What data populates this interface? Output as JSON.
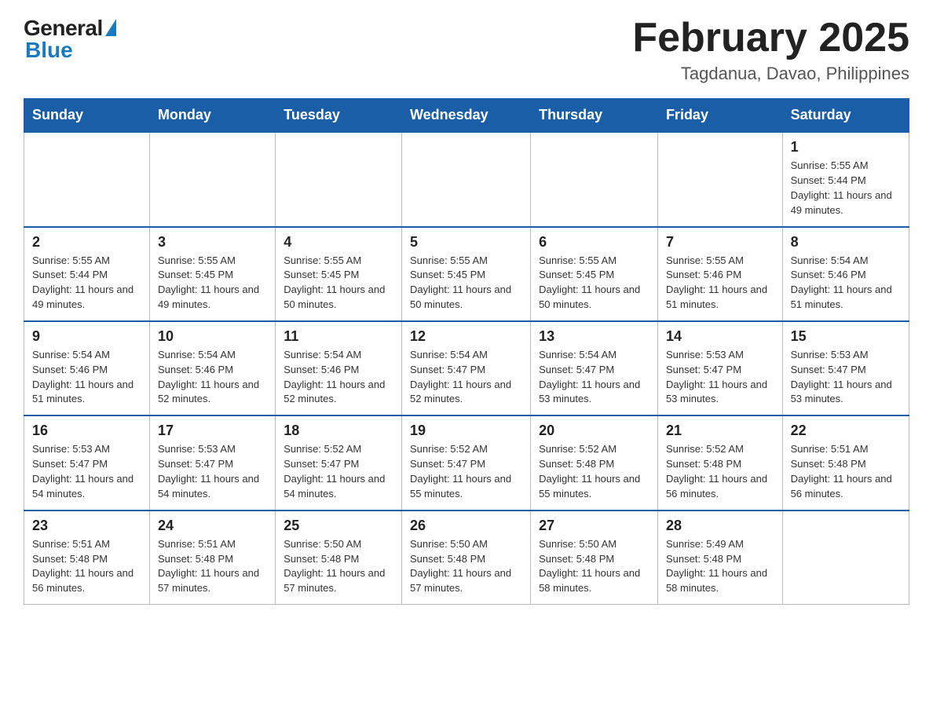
{
  "logo": {
    "general": "General",
    "blue": "Blue"
  },
  "header": {
    "month_title": "February 2025",
    "location": "Tagdanua, Davao, Philippines"
  },
  "days_of_week": [
    "Sunday",
    "Monday",
    "Tuesday",
    "Wednesday",
    "Thursday",
    "Friday",
    "Saturday"
  ],
  "weeks": [
    [
      {
        "day": "",
        "sunrise": "",
        "sunset": "",
        "daylight": "",
        "empty": true
      },
      {
        "day": "",
        "sunrise": "",
        "sunset": "",
        "daylight": "",
        "empty": true
      },
      {
        "day": "",
        "sunrise": "",
        "sunset": "",
        "daylight": "",
        "empty": true
      },
      {
        "day": "",
        "sunrise": "",
        "sunset": "",
        "daylight": "",
        "empty": true
      },
      {
        "day": "",
        "sunrise": "",
        "sunset": "",
        "daylight": "",
        "empty": true
      },
      {
        "day": "",
        "sunrise": "",
        "sunset": "",
        "daylight": "",
        "empty": true
      },
      {
        "day": "1",
        "sunrise": "Sunrise: 5:55 AM",
        "sunset": "Sunset: 5:44 PM",
        "daylight": "Daylight: 11 hours and 49 minutes.",
        "empty": false
      }
    ],
    [
      {
        "day": "2",
        "sunrise": "Sunrise: 5:55 AM",
        "sunset": "Sunset: 5:44 PM",
        "daylight": "Daylight: 11 hours and 49 minutes.",
        "empty": false
      },
      {
        "day": "3",
        "sunrise": "Sunrise: 5:55 AM",
        "sunset": "Sunset: 5:45 PM",
        "daylight": "Daylight: 11 hours and 49 minutes.",
        "empty": false
      },
      {
        "day": "4",
        "sunrise": "Sunrise: 5:55 AM",
        "sunset": "Sunset: 5:45 PM",
        "daylight": "Daylight: 11 hours and 50 minutes.",
        "empty": false
      },
      {
        "day": "5",
        "sunrise": "Sunrise: 5:55 AM",
        "sunset": "Sunset: 5:45 PM",
        "daylight": "Daylight: 11 hours and 50 minutes.",
        "empty": false
      },
      {
        "day": "6",
        "sunrise": "Sunrise: 5:55 AM",
        "sunset": "Sunset: 5:45 PM",
        "daylight": "Daylight: 11 hours and 50 minutes.",
        "empty": false
      },
      {
        "day": "7",
        "sunrise": "Sunrise: 5:55 AM",
        "sunset": "Sunset: 5:46 PM",
        "daylight": "Daylight: 11 hours and 51 minutes.",
        "empty": false
      },
      {
        "day": "8",
        "sunrise": "Sunrise: 5:54 AM",
        "sunset": "Sunset: 5:46 PM",
        "daylight": "Daylight: 11 hours and 51 minutes.",
        "empty": false
      }
    ],
    [
      {
        "day": "9",
        "sunrise": "Sunrise: 5:54 AM",
        "sunset": "Sunset: 5:46 PM",
        "daylight": "Daylight: 11 hours and 51 minutes.",
        "empty": false
      },
      {
        "day": "10",
        "sunrise": "Sunrise: 5:54 AM",
        "sunset": "Sunset: 5:46 PM",
        "daylight": "Daylight: 11 hours and 52 minutes.",
        "empty": false
      },
      {
        "day": "11",
        "sunrise": "Sunrise: 5:54 AM",
        "sunset": "Sunset: 5:46 PM",
        "daylight": "Daylight: 11 hours and 52 minutes.",
        "empty": false
      },
      {
        "day": "12",
        "sunrise": "Sunrise: 5:54 AM",
        "sunset": "Sunset: 5:47 PM",
        "daylight": "Daylight: 11 hours and 52 minutes.",
        "empty": false
      },
      {
        "day": "13",
        "sunrise": "Sunrise: 5:54 AM",
        "sunset": "Sunset: 5:47 PM",
        "daylight": "Daylight: 11 hours and 53 minutes.",
        "empty": false
      },
      {
        "day": "14",
        "sunrise": "Sunrise: 5:53 AM",
        "sunset": "Sunset: 5:47 PM",
        "daylight": "Daylight: 11 hours and 53 minutes.",
        "empty": false
      },
      {
        "day": "15",
        "sunrise": "Sunrise: 5:53 AM",
        "sunset": "Sunset: 5:47 PM",
        "daylight": "Daylight: 11 hours and 53 minutes.",
        "empty": false
      }
    ],
    [
      {
        "day": "16",
        "sunrise": "Sunrise: 5:53 AM",
        "sunset": "Sunset: 5:47 PM",
        "daylight": "Daylight: 11 hours and 54 minutes.",
        "empty": false
      },
      {
        "day": "17",
        "sunrise": "Sunrise: 5:53 AM",
        "sunset": "Sunset: 5:47 PM",
        "daylight": "Daylight: 11 hours and 54 minutes.",
        "empty": false
      },
      {
        "day": "18",
        "sunrise": "Sunrise: 5:52 AM",
        "sunset": "Sunset: 5:47 PM",
        "daylight": "Daylight: 11 hours and 54 minutes.",
        "empty": false
      },
      {
        "day": "19",
        "sunrise": "Sunrise: 5:52 AM",
        "sunset": "Sunset: 5:47 PM",
        "daylight": "Daylight: 11 hours and 55 minutes.",
        "empty": false
      },
      {
        "day": "20",
        "sunrise": "Sunrise: 5:52 AM",
        "sunset": "Sunset: 5:48 PM",
        "daylight": "Daylight: 11 hours and 55 minutes.",
        "empty": false
      },
      {
        "day": "21",
        "sunrise": "Sunrise: 5:52 AM",
        "sunset": "Sunset: 5:48 PM",
        "daylight": "Daylight: 11 hours and 56 minutes.",
        "empty": false
      },
      {
        "day": "22",
        "sunrise": "Sunrise: 5:51 AM",
        "sunset": "Sunset: 5:48 PM",
        "daylight": "Daylight: 11 hours and 56 minutes.",
        "empty": false
      }
    ],
    [
      {
        "day": "23",
        "sunrise": "Sunrise: 5:51 AM",
        "sunset": "Sunset: 5:48 PM",
        "daylight": "Daylight: 11 hours and 56 minutes.",
        "empty": false
      },
      {
        "day": "24",
        "sunrise": "Sunrise: 5:51 AM",
        "sunset": "Sunset: 5:48 PM",
        "daylight": "Daylight: 11 hours and 57 minutes.",
        "empty": false
      },
      {
        "day": "25",
        "sunrise": "Sunrise: 5:50 AM",
        "sunset": "Sunset: 5:48 PM",
        "daylight": "Daylight: 11 hours and 57 minutes.",
        "empty": false
      },
      {
        "day": "26",
        "sunrise": "Sunrise: 5:50 AM",
        "sunset": "Sunset: 5:48 PM",
        "daylight": "Daylight: 11 hours and 57 minutes.",
        "empty": false
      },
      {
        "day": "27",
        "sunrise": "Sunrise: 5:50 AM",
        "sunset": "Sunset: 5:48 PM",
        "daylight": "Daylight: 11 hours and 58 minutes.",
        "empty": false
      },
      {
        "day": "28",
        "sunrise": "Sunrise: 5:49 AM",
        "sunset": "Sunset: 5:48 PM",
        "daylight": "Daylight: 11 hours and 58 minutes.",
        "empty": false
      },
      {
        "day": "",
        "sunrise": "",
        "sunset": "",
        "daylight": "",
        "empty": true
      }
    ]
  ]
}
